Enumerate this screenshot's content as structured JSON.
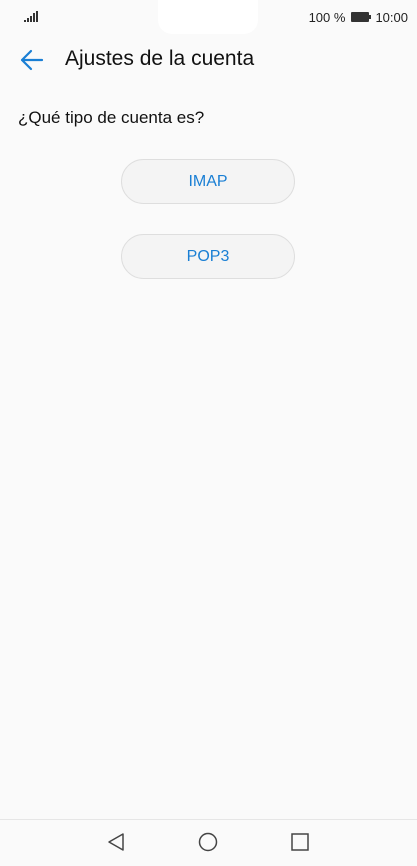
{
  "status_bar": {
    "battery_percent": "100 %",
    "time": "10:00",
    "icons": [
      "signal-icon",
      "battery-icon"
    ]
  },
  "app_bar": {
    "title": "Ajustes de la cuenta",
    "back_icon": "back-arrow-icon"
  },
  "content": {
    "question": "¿Qué tipo de cuenta es?",
    "options": [
      {
        "label": "IMAP"
      },
      {
        "label": "POP3"
      }
    ]
  },
  "nav_bar": {
    "icons": [
      "nav-back-icon",
      "nav-home-icon",
      "nav-recent-icon"
    ]
  },
  "colors": {
    "accent": "#1a7fd4",
    "background": "#fafafa"
  }
}
